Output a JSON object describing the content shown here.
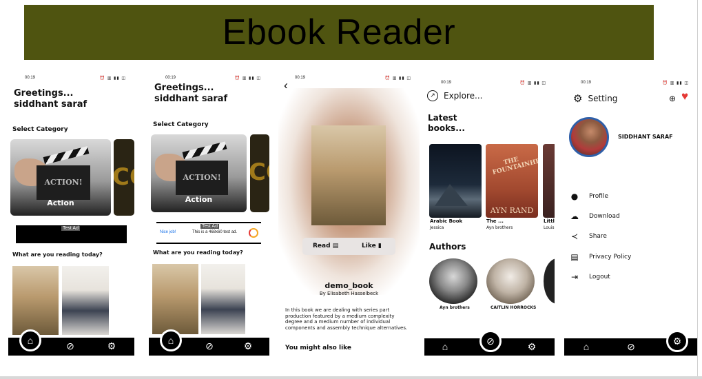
{
  "banner": {
    "title": "Ebook Reader"
  },
  "status": {
    "time": "00:19",
    "icons": "⏰ ▥ ▮▮ ◫"
  },
  "screen1": {
    "greeting_line1": "Greetings...",
    "greeting_line2": "siddhant saraf",
    "select_category": "Select Category",
    "category_title": "Action",
    "clapper_text": "ACTION!",
    "next_card_text": "CO",
    "ad_label": "Test Ad",
    "reading_heading": "What are you reading today?"
  },
  "screen2": {
    "greeting_line1": "Greetings...",
    "greeting_line2": "siddhant saraf",
    "select_category": "Select Category",
    "category_title": "Action",
    "clapper_text": "ACTION!",
    "next_card_text": "CO",
    "ad_label": "Test Ad",
    "ad_nice": "Nice job!",
    "ad_text": "This is a 468x60 test ad.",
    "reading_heading": "What are you reading today?"
  },
  "screen3": {
    "back": "‹",
    "read_label": "Read",
    "like_label": "Like",
    "book_title": "demo_book",
    "book_author": "By Elisabeth Hasselbeck",
    "description": "In this book we are dealing with series part production featured by a medium complexity degree and a medium number of individual components and assembly technique alternatives.",
    "also_like": "You might also like"
  },
  "screen4": {
    "explore": "Explore...",
    "latest_line1": "Latest",
    "latest_line2": "books...",
    "books": [
      {
        "title": "Arabic Book",
        "author": "Jessica"
      },
      {
        "title": "The ...",
        "author": "Ayn brothers"
      },
      {
        "title": "Littl",
        "author": "Louis"
      }
    ],
    "cover2_text": "THE FOUNTAINHEAD",
    "cover2_author": "AYN RAND",
    "authors_heading": "Authors",
    "authors": [
      {
        "name": "Ayn brothers"
      },
      {
        "name": "CAITLIN HORROCKS"
      }
    ]
  },
  "screen5": {
    "setting": "Setting",
    "user_name": "SIDDHANT SARAF",
    "menu": [
      {
        "label": "Profile",
        "icon": "person-icon"
      },
      {
        "label": "Download",
        "icon": "cloud-download-icon"
      },
      {
        "label": "Share",
        "icon": "share-icon"
      },
      {
        "label": "Privacy Policy",
        "icon": "policy-icon"
      },
      {
        "label": "Logout",
        "icon": "logout-icon"
      }
    ]
  },
  "colors": {
    "banner": "#4f5410",
    "nav": "#000000",
    "heart": "#e53935",
    "avatar_ring": "#2f5fa8"
  }
}
